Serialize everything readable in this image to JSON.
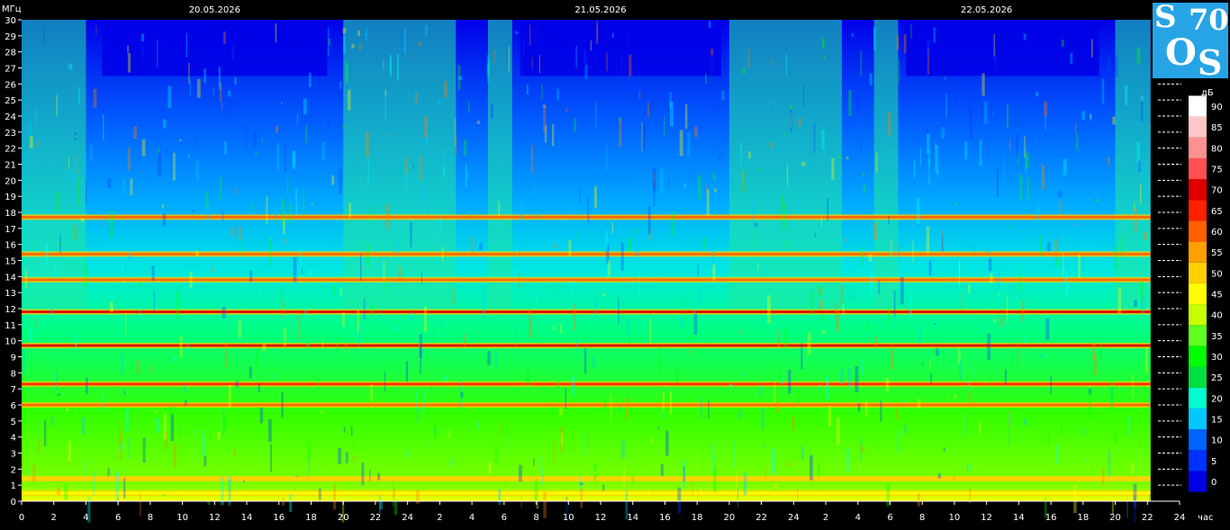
{
  "chart_data": {
    "type": "heatmap",
    "title": "",
    "ylabel": "МГц",
    "xlabel": "час",
    "dates": [
      "20.05.2026",
      "21.05.2026",
      "22.05.2026"
    ],
    "y_ticks": [
      "0",
      "1",
      "2",
      "3",
      "4",
      "5",
      "6",
      "7",
      "8",
      "9",
      "10",
      "11",
      "12",
      "13",
      "14",
      "15",
      "16",
      "17",
      "18",
      "19",
      "20",
      "21",
      "22",
      "23",
      "24",
      "25",
      "26",
      "27",
      "28",
      "29",
      "30"
    ],
    "x_ticks": [
      "0",
      "2",
      "4",
      "6",
      "8",
      "10",
      "12",
      "14",
      "16",
      "18",
      "20",
      "22",
      "24",
      "2",
      "4",
      "6",
      "8",
      "10",
      "12",
      "14",
      "16",
      "18",
      "20",
      "22",
      "24",
      "2",
      "4",
      "6",
      "8",
      "10",
      "12",
      "14",
      "16",
      "18",
      "20",
      "22",
      "24"
    ],
    "ylim": [
      0,
      30
    ],
    "x_range_hours": [
      0,
      72
    ],
    "data_end_hour": 70.2,
    "colorbar": {
      "unit": "дБ",
      "ticks": [
        "0",
        "5",
        "10",
        "15",
        "20",
        "25",
        "30",
        "35",
        "40",
        "45",
        "50",
        "55",
        "60",
        "65",
        "70",
        "75",
        "80",
        "85",
        "90"
      ],
      "colors": [
        "#0000e6",
        "#0032ff",
        "#0064ff",
        "#00c8ff",
        "#00ffd0",
        "#00e040",
        "#00ff00",
        "#60ff20",
        "#c8ff00",
        "#ffff00",
        "#ffd000",
        "#ffa000",
        "#ff6000",
        "#ff2000",
        "#e00000",
        "#ff5050",
        "#ff9090",
        "#ffc8c8",
        "#ffffff"
      ]
    },
    "bands_mhz": [
      {
        "freq": 0.5,
        "db": 45
      },
      {
        "freq": 1.4,
        "db": 48
      },
      {
        "freq": 6.0,
        "db": 62
      },
      {
        "freq": 7.3,
        "db": 66
      },
      {
        "freq": 9.7,
        "db": 70
      },
      {
        "freq": 11.8,
        "db": 68
      },
      {
        "freq": 13.8,
        "db": 58
      },
      {
        "freq": 15.4,
        "db": 60
      },
      {
        "freq": 17.7,
        "db": 62
      }
    ],
    "grid": false
  },
  "logo": {
    "t1": "S",
    "t2": "70",
    "t3": "O",
    "t4": "S"
  }
}
